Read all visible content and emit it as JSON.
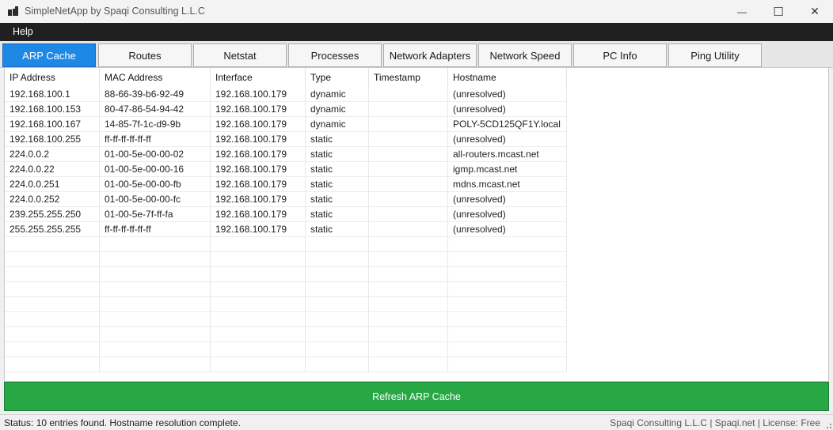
{
  "window": {
    "title": "SimpleNetApp by Spaqi Consulting L.L.C",
    "minimize_glyph": "—",
    "maximize_glyph": "☐",
    "close_glyph": "✕"
  },
  "menu": {
    "help": "Help"
  },
  "tabs": [
    {
      "label": "ARP Cache"
    },
    {
      "label": "Routes"
    },
    {
      "label": "Netstat"
    },
    {
      "label": "Processes"
    },
    {
      "label": "Network Adapters"
    },
    {
      "label": "Network Speed"
    },
    {
      "label": "PC Info"
    },
    {
      "label": "Ping Utility"
    }
  ],
  "table": {
    "headers": [
      "IP Address",
      "MAC Address",
      "Interface",
      "Type",
      "Timestamp",
      "Hostname"
    ],
    "rows": [
      [
        "192.168.100.1",
        "88-66-39-b6-92-49",
        "192.168.100.179",
        "dynamic",
        "",
        "(unresolved)"
      ],
      [
        "192.168.100.153",
        "80-47-86-54-94-42",
        "192.168.100.179",
        "dynamic",
        "",
        "(unresolved)"
      ],
      [
        "192.168.100.167",
        "14-85-7f-1c-d9-9b",
        "192.168.100.179",
        "dynamic",
        "",
        "POLY-5CD125QF1Y.local"
      ],
      [
        "192.168.100.255",
        "ff-ff-ff-ff-ff-ff",
        "192.168.100.179",
        "static",
        "",
        "(unresolved)"
      ],
      [
        "224.0.0.2",
        "01-00-5e-00-00-02",
        "192.168.100.179",
        "static",
        "",
        "all-routers.mcast.net"
      ],
      [
        "224.0.0.22",
        "01-00-5e-00-00-16",
        "192.168.100.179",
        "static",
        "",
        "igmp.mcast.net"
      ],
      [
        "224.0.0.251",
        "01-00-5e-00-00-fb",
        "192.168.100.179",
        "static",
        "",
        "mdns.mcast.net"
      ],
      [
        "224.0.0.252",
        "01-00-5e-00-00-fc",
        "192.168.100.179",
        "static",
        "",
        "(unresolved)"
      ],
      [
        "239.255.255.250",
        "01-00-5e-7f-ff-fa",
        "192.168.100.179",
        "static",
        "",
        "(unresolved)"
      ],
      [
        "255.255.255.255",
        "ff-ff-ff-ff-ff-ff",
        "192.168.100.179",
        "static",
        "",
        "(unresolved)"
      ]
    ]
  },
  "refresh_button": "Refresh ARP Cache",
  "status": {
    "left": "Status: 10 entries found. Hostname resolution complete.",
    "right": "Spaqi Consulting L.L.C | Spaqi.net | License: Free"
  },
  "colors": {
    "active_tab": "#1e88e5",
    "refresh_button": "#28a745",
    "menubar": "#202020"
  }
}
